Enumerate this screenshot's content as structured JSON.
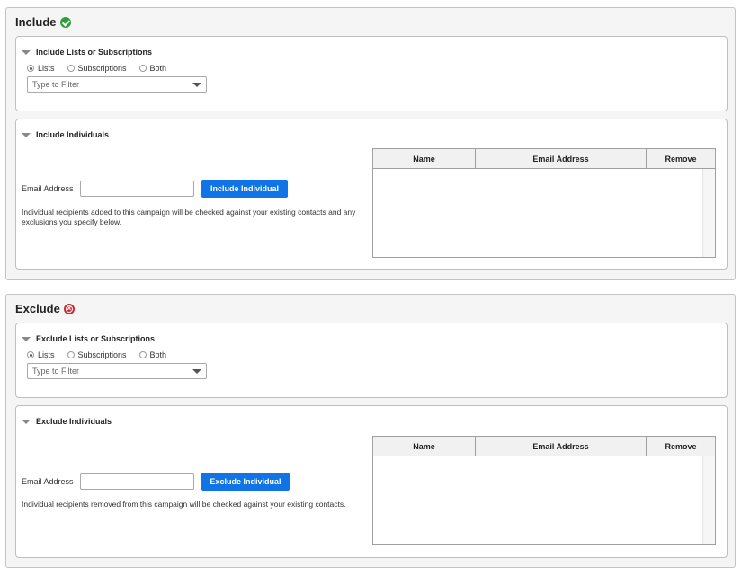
{
  "include": {
    "title": "Include",
    "lists_section": {
      "header": "Include Lists or Subscriptions",
      "options": [
        "Lists",
        "Subscriptions",
        "Both"
      ],
      "selected": "Lists",
      "filter_placeholder": "Type to Filter"
    },
    "individuals_section": {
      "header": "Include Individuals",
      "email_label": "Email Address",
      "email_value": "",
      "button_label": "Include Individual",
      "help_text": "Individual recipients added to this campaign will be checked against your existing contacts and any exclusions you specify below.",
      "table_columns": [
        "Name",
        "Email Address",
        "Remove"
      ],
      "rows": []
    }
  },
  "exclude": {
    "title": "Exclude",
    "lists_section": {
      "header": "Exclude Lists or Subscriptions",
      "options": [
        "Lists",
        "Subscriptions",
        "Both"
      ],
      "selected": "Lists",
      "filter_placeholder": "Type to Filter"
    },
    "individuals_section": {
      "header": "Exclude Individuals",
      "email_label": "Email Address",
      "email_value": "",
      "button_label": "Exclude Individual",
      "help_text": "Individual recipients removed from this campaign will be checked against your existing contacts.",
      "table_columns": [
        "Name",
        "Email Address",
        "Remove"
      ],
      "rows": []
    }
  },
  "colors": {
    "include_icon": "#2e9e3a",
    "exclude_icon": "#d0282e",
    "button": "#1174e6"
  }
}
